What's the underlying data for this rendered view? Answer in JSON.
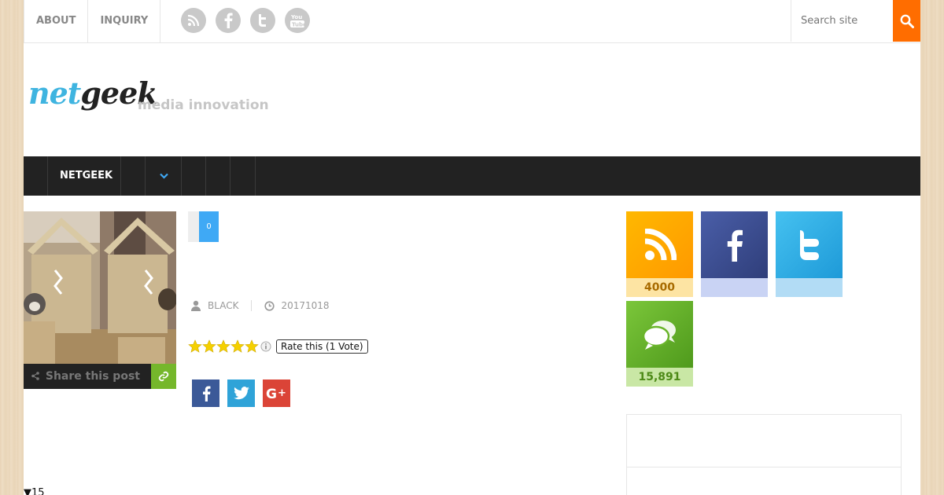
{
  "topnav": {
    "items": [
      {
        "label": "ABOUT"
      },
      {
        "label": "INQUIRY"
      }
    ]
  },
  "social_top": [
    "rss-icon",
    "facebook-icon",
    "twitter-icon",
    "youtube-icon"
  ],
  "search": {
    "placeholder": "Search site",
    "button_color": "#ff6d00"
  },
  "header": {
    "logo": {
      "part1": "net",
      "part2": "geek"
    },
    "tagline": "media innovation"
  },
  "navbar": {
    "item_label": "NETGEEK"
  },
  "post": {
    "share_label": "Share this post",
    "comment_count": "0",
    "author": "BLACK",
    "date": "20171018",
    "rating": {
      "value": 5,
      "max": 5,
      "label": "Rate this (1 Vote)"
    },
    "share_buttons": [
      "facebook-icon",
      "twitter-icon",
      "google-plus-icon"
    ]
  },
  "sidebar": {
    "widgets": [
      {
        "name": "rss",
        "count": "4000",
        "color": "#ffa800",
        "bar_color": "#fde4a3",
        "text_color": "#a86b00"
      },
      {
        "name": "facebook",
        "count": "",
        "color": "#3b4c8c",
        "bar_color": "#c9d3f4"
      },
      {
        "name": "twitter",
        "count": "",
        "color": "#30aee8",
        "bar_color": "#b2dcf5"
      },
      {
        "name": "comments",
        "count": "15,891",
        "color": "#6ab52b",
        "bar_color": "#c9e7a5",
        "text_color": "#4d8a17"
      }
    ]
  },
  "footer": {
    "count": "▼15"
  },
  "colors": {
    "accent": "#3fa9f5",
    "dark_nav": "#222222",
    "share_green": "#75b72b"
  }
}
